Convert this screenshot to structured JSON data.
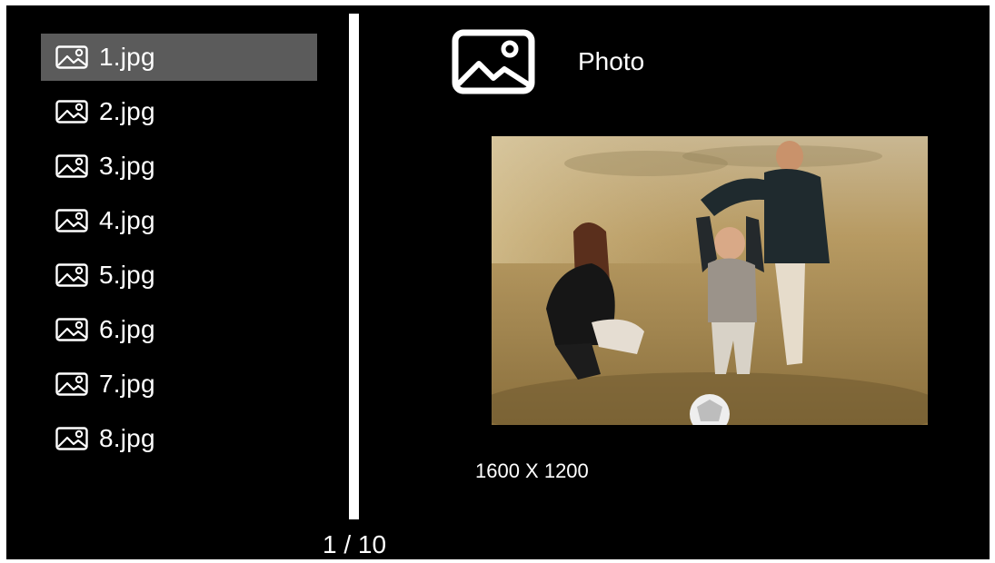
{
  "file_list": {
    "items": [
      {
        "label": "1.jpg",
        "icon": "image-icon",
        "selected": true
      },
      {
        "label": "2.jpg",
        "icon": "image-icon",
        "selected": false
      },
      {
        "label": "3.jpg",
        "icon": "image-icon",
        "selected": false
      },
      {
        "label": "4.jpg",
        "icon": "image-icon",
        "selected": false
      },
      {
        "label": "5.jpg",
        "icon": "image-icon",
        "selected": false
      },
      {
        "label": "6.jpg",
        "icon": "image-icon",
        "selected": false
      },
      {
        "label": "7.jpg",
        "icon": "image-icon",
        "selected": false
      },
      {
        "label": "8.jpg",
        "icon": "image-icon",
        "selected": false
      }
    ]
  },
  "pagination": {
    "text": "1 / 10"
  },
  "preview": {
    "icon": "photo-icon",
    "type_label": "Photo",
    "resolution": "1600 X 1200"
  },
  "colors": {
    "background": "#000000",
    "text": "#ffffff",
    "selected_row": "#5b5b5b"
  }
}
